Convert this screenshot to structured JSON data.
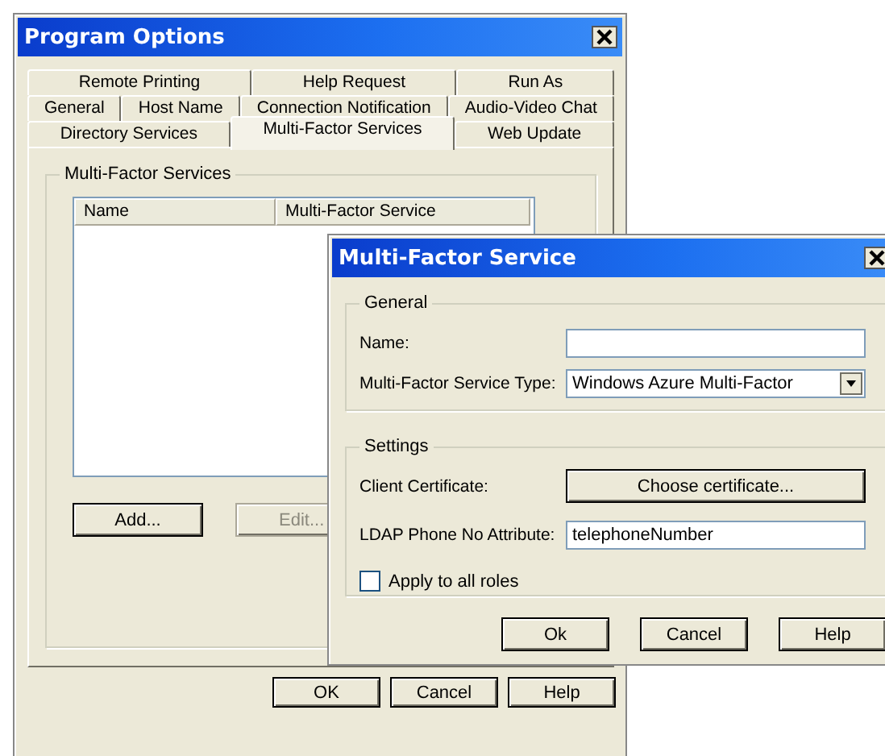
{
  "main_window": {
    "title": "Program Options",
    "tab_rows": [
      [
        {
          "label": "Remote Printing",
          "selected": false
        },
        {
          "label": "Help Request",
          "selected": false
        },
        {
          "label": "Run As",
          "selected": false
        }
      ],
      [
        {
          "label": "General",
          "selected": false
        },
        {
          "label": "Host Name",
          "selected": false
        },
        {
          "label": "Connection Notification",
          "selected": false
        },
        {
          "label": "Audio-Video Chat",
          "selected": false
        }
      ],
      [
        {
          "label": "Directory Services",
          "selected": false
        },
        {
          "label": "Multi-Factor Services",
          "selected": true
        },
        {
          "label": "Web Update",
          "selected": false
        }
      ]
    ],
    "group_title": "Multi-Factor Services",
    "list_columns": [
      "Name",
      "Multi-Factor Service"
    ],
    "list_buttons": [
      {
        "label": "Add...",
        "disabled": false
      },
      {
        "label": "Edit...",
        "disabled": true
      }
    ],
    "buttons": [
      "OK",
      "Cancel",
      "Help"
    ]
  },
  "dialog": {
    "title": "Multi-Factor Service",
    "general": {
      "title": "General",
      "name_label": "Name:",
      "type_label": "Multi-Factor Service Type:",
      "type_value": "Windows Azure Multi-Factor"
    },
    "settings": {
      "title": "Settings",
      "certificate_label": "Client Certificate:",
      "certificate_button": "Choose certificate...",
      "ldap_label": "LDAP Phone No Attribute:",
      "ldap_value": "telephoneNumber",
      "apply_label": "Apply to all roles",
      "apply_checked": false
    },
    "buttons": [
      "Ok",
      "Cancel",
      "Help"
    ]
  }
}
